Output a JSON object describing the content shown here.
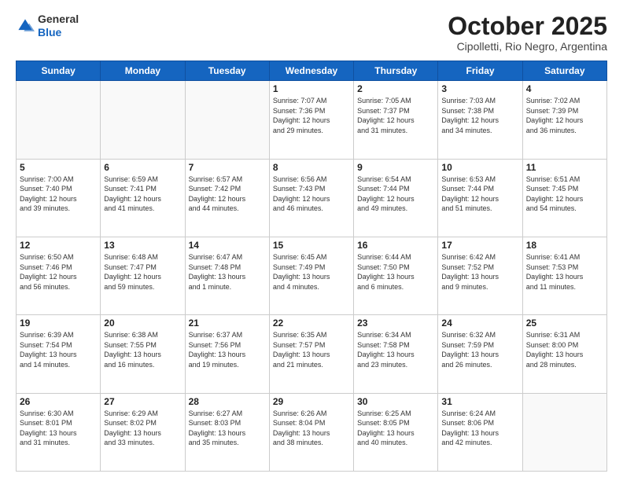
{
  "header": {
    "logo_general": "General",
    "logo_blue": "Blue",
    "month_title": "October 2025",
    "subtitle": "Cipolletti, Rio Negro, Argentina"
  },
  "weekdays": [
    "Sunday",
    "Monday",
    "Tuesday",
    "Wednesday",
    "Thursday",
    "Friday",
    "Saturday"
  ],
  "weeks": [
    [
      {
        "day": "",
        "info": ""
      },
      {
        "day": "",
        "info": ""
      },
      {
        "day": "",
        "info": ""
      },
      {
        "day": "1",
        "info": "Sunrise: 7:07 AM\nSunset: 7:36 PM\nDaylight: 12 hours\nand 29 minutes."
      },
      {
        "day": "2",
        "info": "Sunrise: 7:05 AM\nSunset: 7:37 PM\nDaylight: 12 hours\nand 31 minutes."
      },
      {
        "day": "3",
        "info": "Sunrise: 7:03 AM\nSunset: 7:38 PM\nDaylight: 12 hours\nand 34 minutes."
      },
      {
        "day": "4",
        "info": "Sunrise: 7:02 AM\nSunset: 7:39 PM\nDaylight: 12 hours\nand 36 minutes."
      }
    ],
    [
      {
        "day": "5",
        "info": "Sunrise: 7:00 AM\nSunset: 7:40 PM\nDaylight: 12 hours\nand 39 minutes."
      },
      {
        "day": "6",
        "info": "Sunrise: 6:59 AM\nSunset: 7:41 PM\nDaylight: 12 hours\nand 41 minutes."
      },
      {
        "day": "7",
        "info": "Sunrise: 6:57 AM\nSunset: 7:42 PM\nDaylight: 12 hours\nand 44 minutes."
      },
      {
        "day": "8",
        "info": "Sunrise: 6:56 AM\nSunset: 7:43 PM\nDaylight: 12 hours\nand 46 minutes."
      },
      {
        "day": "9",
        "info": "Sunrise: 6:54 AM\nSunset: 7:44 PM\nDaylight: 12 hours\nand 49 minutes."
      },
      {
        "day": "10",
        "info": "Sunrise: 6:53 AM\nSunset: 7:44 PM\nDaylight: 12 hours\nand 51 minutes."
      },
      {
        "day": "11",
        "info": "Sunrise: 6:51 AM\nSunset: 7:45 PM\nDaylight: 12 hours\nand 54 minutes."
      }
    ],
    [
      {
        "day": "12",
        "info": "Sunrise: 6:50 AM\nSunset: 7:46 PM\nDaylight: 12 hours\nand 56 minutes."
      },
      {
        "day": "13",
        "info": "Sunrise: 6:48 AM\nSunset: 7:47 PM\nDaylight: 12 hours\nand 59 minutes."
      },
      {
        "day": "14",
        "info": "Sunrise: 6:47 AM\nSunset: 7:48 PM\nDaylight: 13 hours\nand 1 minute."
      },
      {
        "day": "15",
        "info": "Sunrise: 6:45 AM\nSunset: 7:49 PM\nDaylight: 13 hours\nand 4 minutes."
      },
      {
        "day": "16",
        "info": "Sunrise: 6:44 AM\nSunset: 7:50 PM\nDaylight: 13 hours\nand 6 minutes."
      },
      {
        "day": "17",
        "info": "Sunrise: 6:42 AM\nSunset: 7:52 PM\nDaylight: 13 hours\nand 9 minutes."
      },
      {
        "day": "18",
        "info": "Sunrise: 6:41 AM\nSunset: 7:53 PM\nDaylight: 13 hours\nand 11 minutes."
      }
    ],
    [
      {
        "day": "19",
        "info": "Sunrise: 6:39 AM\nSunset: 7:54 PM\nDaylight: 13 hours\nand 14 minutes."
      },
      {
        "day": "20",
        "info": "Sunrise: 6:38 AM\nSunset: 7:55 PM\nDaylight: 13 hours\nand 16 minutes."
      },
      {
        "day": "21",
        "info": "Sunrise: 6:37 AM\nSunset: 7:56 PM\nDaylight: 13 hours\nand 19 minutes."
      },
      {
        "day": "22",
        "info": "Sunrise: 6:35 AM\nSunset: 7:57 PM\nDaylight: 13 hours\nand 21 minutes."
      },
      {
        "day": "23",
        "info": "Sunrise: 6:34 AM\nSunset: 7:58 PM\nDaylight: 13 hours\nand 23 minutes."
      },
      {
        "day": "24",
        "info": "Sunrise: 6:32 AM\nSunset: 7:59 PM\nDaylight: 13 hours\nand 26 minutes."
      },
      {
        "day": "25",
        "info": "Sunrise: 6:31 AM\nSunset: 8:00 PM\nDaylight: 13 hours\nand 28 minutes."
      }
    ],
    [
      {
        "day": "26",
        "info": "Sunrise: 6:30 AM\nSunset: 8:01 PM\nDaylight: 13 hours\nand 31 minutes."
      },
      {
        "day": "27",
        "info": "Sunrise: 6:29 AM\nSunset: 8:02 PM\nDaylight: 13 hours\nand 33 minutes."
      },
      {
        "day": "28",
        "info": "Sunrise: 6:27 AM\nSunset: 8:03 PM\nDaylight: 13 hours\nand 35 minutes."
      },
      {
        "day": "29",
        "info": "Sunrise: 6:26 AM\nSunset: 8:04 PM\nDaylight: 13 hours\nand 38 minutes."
      },
      {
        "day": "30",
        "info": "Sunrise: 6:25 AM\nSunset: 8:05 PM\nDaylight: 13 hours\nand 40 minutes."
      },
      {
        "day": "31",
        "info": "Sunrise: 6:24 AM\nSunset: 8:06 PM\nDaylight: 13 hours\nand 42 minutes."
      },
      {
        "day": "",
        "info": ""
      }
    ]
  ]
}
